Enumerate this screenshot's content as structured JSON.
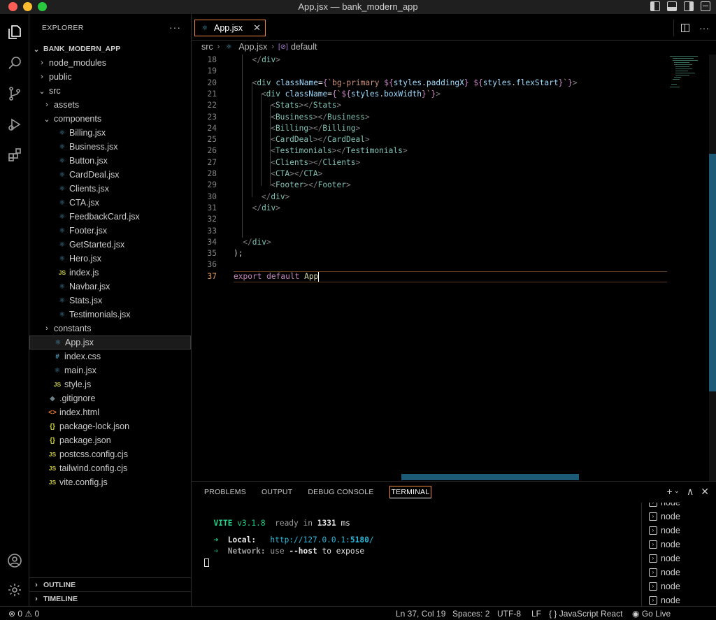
{
  "window": {
    "title": "App.jsx — bank_modern_app"
  },
  "explorer": {
    "header": "EXPLORER",
    "more": "···",
    "root": "BANK_MODERN_APP",
    "items": [
      {
        "label": "node_modules",
        "type": "folder",
        "expanded": false,
        "depth": 1
      },
      {
        "label": "public",
        "type": "folder",
        "expanded": false,
        "depth": 1
      },
      {
        "label": "src",
        "type": "folder",
        "expanded": true,
        "depth": 1
      },
      {
        "label": "assets",
        "type": "folder",
        "expanded": false,
        "depth": 2
      },
      {
        "label": "components",
        "type": "folder",
        "expanded": true,
        "depth": 2
      },
      {
        "label": "Billing.jsx",
        "type": "react",
        "depth": 3
      },
      {
        "label": "Business.jsx",
        "type": "react",
        "depth": 3
      },
      {
        "label": "Button.jsx",
        "type": "react",
        "depth": 3
      },
      {
        "label": "CardDeal.jsx",
        "type": "react",
        "depth": 3
      },
      {
        "label": "Clients.jsx",
        "type": "react",
        "depth": 3
      },
      {
        "label": "CTA.jsx",
        "type": "react",
        "depth": 3
      },
      {
        "label": "FeedbackCard.jsx",
        "type": "react",
        "depth": 3
      },
      {
        "label": "Footer.jsx",
        "type": "react",
        "depth": 3
      },
      {
        "label": "GetStarted.jsx",
        "type": "react",
        "depth": 3
      },
      {
        "label": "Hero.jsx",
        "type": "react",
        "depth": 3
      },
      {
        "label": "index.js",
        "type": "js",
        "depth": 3
      },
      {
        "label": "Navbar.jsx",
        "type": "react",
        "depth": 3
      },
      {
        "label": "Stats.jsx",
        "type": "react",
        "depth": 3
      },
      {
        "label": "Testimonials.jsx",
        "type": "react",
        "depth": 3
      },
      {
        "label": "constants",
        "type": "folder",
        "expanded": false,
        "depth": 2
      },
      {
        "label": "App.jsx",
        "type": "react",
        "depth": 2,
        "selected": true
      },
      {
        "label": "index.css",
        "type": "css",
        "depth": 2
      },
      {
        "label": "main.jsx",
        "type": "react",
        "depth": 2
      },
      {
        "label": "style.js",
        "type": "js",
        "depth": 2
      },
      {
        "label": ".gitignore",
        "type": "git",
        "depth": 1
      },
      {
        "label": "index.html",
        "type": "html",
        "depth": 1
      },
      {
        "label": "package-lock.json",
        "type": "json",
        "depth": 1
      },
      {
        "label": "package.json",
        "type": "json",
        "depth": 1
      },
      {
        "label": "postcss.config.cjs",
        "type": "js",
        "depth": 1
      },
      {
        "label": "tailwind.config.cjs",
        "type": "js",
        "depth": 1
      },
      {
        "label": "vite.config.js",
        "type": "js",
        "depth": 1
      }
    ],
    "outline": "OUTLINE",
    "timeline": "TIMELINE"
  },
  "editor": {
    "tab": {
      "label": "App.jsx",
      "close": "✕"
    },
    "breadcrumb": {
      "folder": "src",
      "file": "App.jsx",
      "symbol": "default",
      "symbol_icon": "[⊘]"
    },
    "current_line": 37,
    "lines": [
      {
        "n": "18",
        "indent": 2,
        "tokens": [
          [
            "br",
            "</"
          ],
          [
            "tag",
            "div"
          ],
          [
            "br",
            ">"
          ]
        ]
      },
      {
        "n": "19",
        "indent": 0,
        "tokens": []
      },
      {
        "n": "20",
        "indent": 2,
        "tokens": [
          [
            "br",
            "<"
          ],
          [
            "tag",
            "div"
          ],
          [
            "pl",
            " "
          ],
          [
            "attr",
            "className"
          ],
          [
            "pl",
            "="
          ],
          [
            "kw",
            "{"
          ],
          [
            "str",
            "`bg-primary "
          ],
          [
            "kw",
            "${"
          ],
          [
            "attr",
            "styles"
          ],
          [
            "pl",
            "."
          ],
          [
            "attr",
            "paddingX"
          ],
          [
            "kw",
            "}"
          ],
          [
            "str",
            " "
          ],
          [
            "kw",
            "${"
          ],
          [
            "attr",
            "styles"
          ],
          [
            "pl",
            "."
          ],
          [
            "attr",
            "flexStart"
          ],
          [
            "kw",
            "}"
          ],
          [
            "str",
            "`"
          ],
          [
            "kw",
            "}"
          ],
          [
            "br",
            ">"
          ]
        ]
      },
      {
        "n": "21",
        "indent": 3,
        "tokens": [
          [
            "br",
            "<"
          ],
          [
            "tag",
            "div"
          ],
          [
            "pl",
            " "
          ],
          [
            "attr",
            "className"
          ],
          [
            "pl",
            "="
          ],
          [
            "kw",
            "{"
          ],
          [
            "str",
            "`"
          ],
          [
            "kw",
            "${"
          ],
          [
            "attr",
            "styles"
          ],
          [
            "pl",
            "."
          ],
          [
            "attr",
            "boxWidth"
          ],
          [
            "kw",
            "}"
          ],
          [
            "str",
            "`"
          ],
          [
            "kw",
            "}"
          ],
          [
            "br",
            ">"
          ]
        ]
      },
      {
        "n": "22",
        "indent": 4,
        "tokens": [
          [
            "br",
            "<"
          ],
          [
            "tag",
            "Stats"
          ],
          [
            "br",
            "></"
          ],
          [
            "tag",
            "Stats"
          ],
          [
            "br",
            ">"
          ]
        ]
      },
      {
        "n": "23",
        "indent": 4,
        "tokens": [
          [
            "br",
            "<"
          ],
          [
            "tag",
            "Business"
          ],
          [
            "br",
            "></"
          ],
          [
            "tag",
            "Business"
          ],
          [
            "br",
            ">"
          ]
        ]
      },
      {
        "n": "24",
        "indent": 4,
        "tokens": [
          [
            "br",
            "<"
          ],
          [
            "tag",
            "Billing"
          ],
          [
            "br",
            "></"
          ],
          [
            "tag",
            "Billing"
          ],
          [
            "br",
            ">"
          ]
        ]
      },
      {
        "n": "25",
        "indent": 4,
        "tokens": [
          [
            "br",
            "<"
          ],
          [
            "tag",
            "CardDeal"
          ],
          [
            "br",
            "></"
          ],
          [
            "tag",
            "CardDeal"
          ],
          [
            "br",
            ">"
          ]
        ]
      },
      {
        "n": "26",
        "indent": 4,
        "tokens": [
          [
            "br",
            "<"
          ],
          [
            "tag",
            "Testimonials"
          ],
          [
            "br",
            "></"
          ],
          [
            "tag",
            "Testimonials"
          ],
          [
            "br",
            ">"
          ]
        ]
      },
      {
        "n": "27",
        "indent": 4,
        "tokens": [
          [
            "br",
            "<"
          ],
          [
            "tag",
            "Clients"
          ],
          [
            "br",
            "></"
          ],
          [
            "tag",
            "Clients"
          ],
          [
            "br",
            ">"
          ]
        ]
      },
      {
        "n": "28",
        "indent": 4,
        "tokens": [
          [
            "br",
            "<"
          ],
          [
            "tag",
            "CTA"
          ],
          [
            "br",
            "></"
          ],
          [
            "tag",
            "CTA"
          ],
          [
            "br",
            ">"
          ]
        ]
      },
      {
        "n": "29",
        "indent": 4,
        "tokens": [
          [
            "br",
            "<"
          ],
          [
            "tag",
            "Footer"
          ],
          [
            "br",
            "></"
          ],
          [
            "tag",
            "Footer"
          ],
          [
            "br",
            ">"
          ]
        ]
      },
      {
        "n": "30",
        "indent": 3,
        "tokens": [
          [
            "br",
            "</"
          ],
          [
            "tag",
            "div"
          ],
          [
            "br",
            ">"
          ]
        ]
      },
      {
        "n": "31",
        "indent": 2,
        "tokens": [
          [
            "br",
            "</"
          ],
          [
            "tag",
            "div"
          ],
          [
            "br",
            ">"
          ]
        ]
      },
      {
        "n": "32",
        "indent": 0,
        "tokens": []
      },
      {
        "n": "33",
        "indent": 0,
        "tokens": []
      },
      {
        "n": "34",
        "indent": 1,
        "tokens": [
          [
            "br",
            "</"
          ],
          [
            "tag",
            "div"
          ],
          [
            "br",
            ">"
          ]
        ]
      },
      {
        "n": "35",
        "indent": 0,
        "tokens": [
          [
            "pl",
            ");"
          ]
        ]
      },
      {
        "n": "36",
        "indent": 0,
        "tokens": []
      },
      {
        "n": "37",
        "indent": 0,
        "tokens": [
          [
            "kw",
            "export"
          ],
          [
            "pl",
            " "
          ],
          [
            "kw",
            "default"
          ],
          [
            "pl",
            " "
          ],
          [
            "fn",
            "App"
          ]
        ]
      }
    ]
  },
  "panel": {
    "tabs": [
      "PROBLEMS",
      "OUTPUT",
      "DEBUG CONSOLE",
      "TERMINAL"
    ],
    "active_tab": "TERMINAL",
    "actions": {
      "add": "+",
      "dropdown": "⌄",
      "maximize": "∧",
      "close": "✕"
    },
    "terminal": {
      "vite": "VITE",
      "version": "v3.1.8",
      "ready": "ready in",
      "ms_value": "1331",
      "ms": "ms",
      "arrow": "➜",
      "local_label": "Local:",
      "local_url_base": "http://127.0.0.1:",
      "local_port": "5180",
      "local_slash": "/",
      "network_label": "Network:",
      "network_use": "use",
      "network_flag": "--host",
      "network_rest": "to expose"
    },
    "terminal_list": [
      "node",
      "node",
      "node",
      "node",
      "node",
      "node",
      "node",
      "node"
    ]
  },
  "statusbar": {
    "errors": "0",
    "warnings": "0",
    "position": "Ln 37, Col 19",
    "spaces": "Spaces: 2",
    "encoding": "UTF-8",
    "eol": "LF",
    "language_icon": "{ }",
    "language": "JavaScript React",
    "golive": "Go Live"
  }
}
